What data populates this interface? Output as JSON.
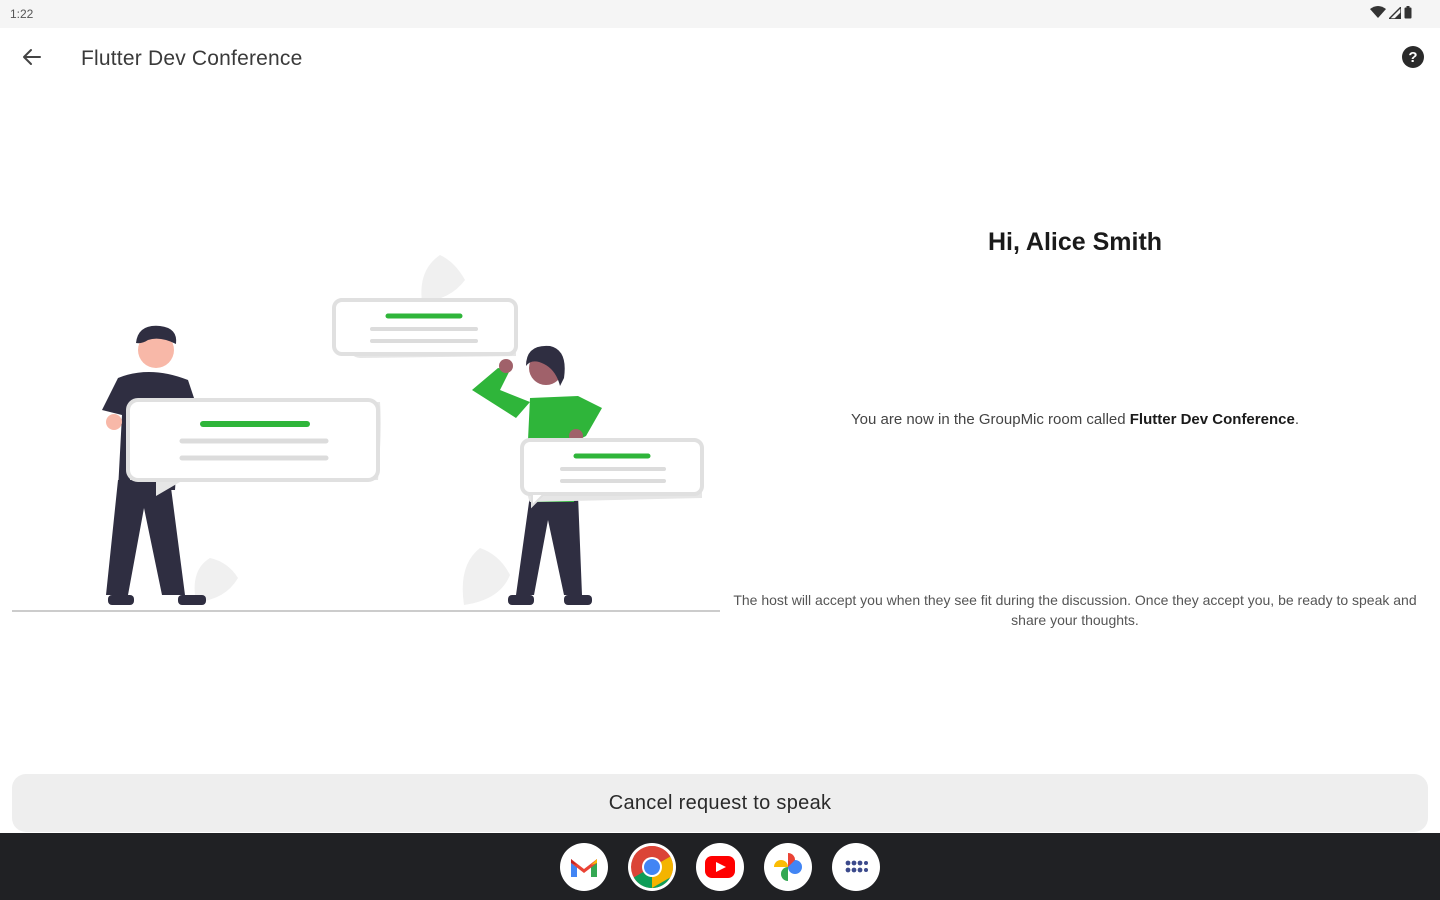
{
  "status_bar": {
    "time": "1:22"
  },
  "app_bar": {
    "title": "Flutter Dev Conference"
  },
  "content": {
    "greeting": "Hi, Alice Smith",
    "room_prefix": "You are now in the GroupMic room called ",
    "room_name": "Flutter Dev Conference",
    "room_suffix": ".",
    "host_message": "The host will accept you when they see fit during the discussion. Once they accept you, be ready to speak and share your thoughts."
  },
  "actions": {
    "cancel_label": "Cancel request to speak"
  },
  "taskbar": {
    "apps": [
      "gmail-icon",
      "chrome-icon",
      "youtube-icon",
      "photos-icon",
      "app-launcher-icon"
    ]
  },
  "colors": {
    "accent_green": "#2fb53a",
    "button_bg": "#eeeeee",
    "taskbar_bg": "#202124"
  }
}
